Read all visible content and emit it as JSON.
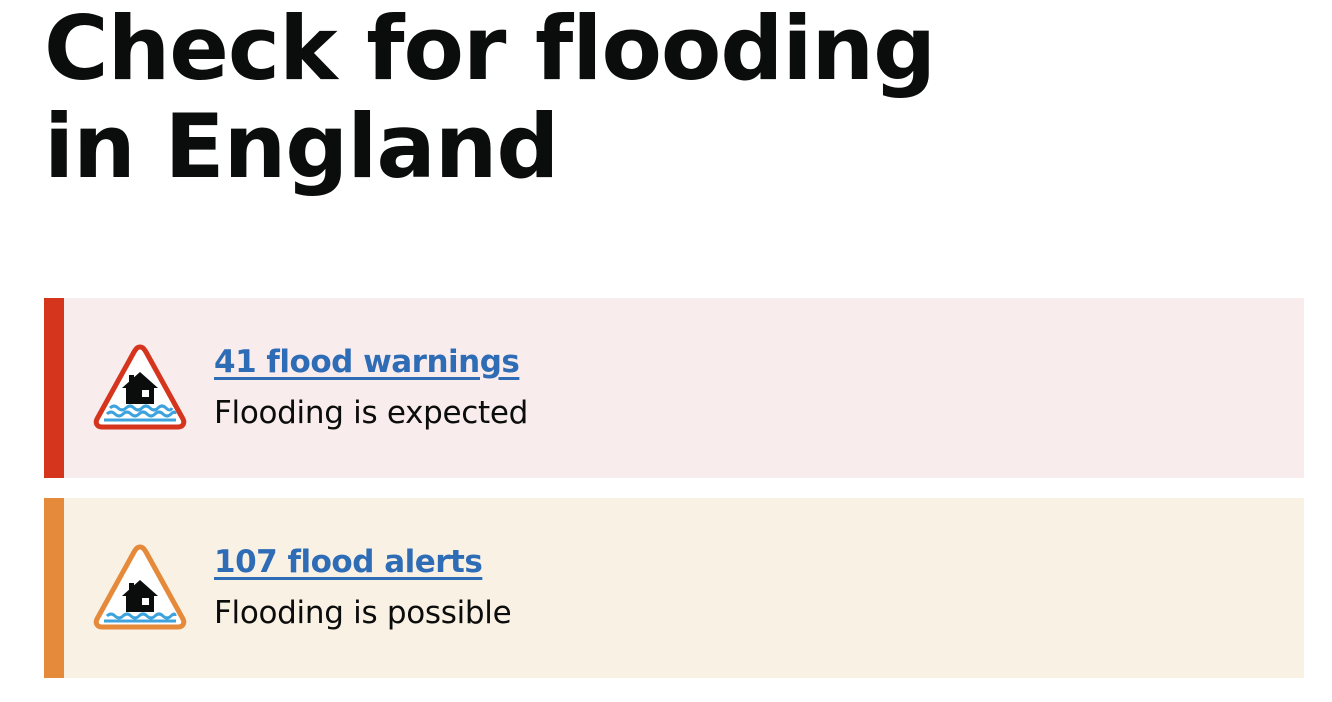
{
  "page": {
    "title": "Check for flooding in England"
  },
  "summaries": [
    {
      "icon": "flood-warning-icon",
      "link_text": "41 flood warnings",
      "description": "Flooding is expected",
      "accent_color": "#d4351c",
      "background_color": "#f9ecec"
    },
    {
      "icon": "flood-alert-icon",
      "link_text": "107 flood alerts",
      "description": "Flooding is possible",
      "accent_color": "#e5893a",
      "background_color": "#faf1e5"
    }
  ],
  "colors": {
    "link": "#2e6cb6",
    "text": "#0b0c0c",
    "water": "#3ea3dd"
  }
}
